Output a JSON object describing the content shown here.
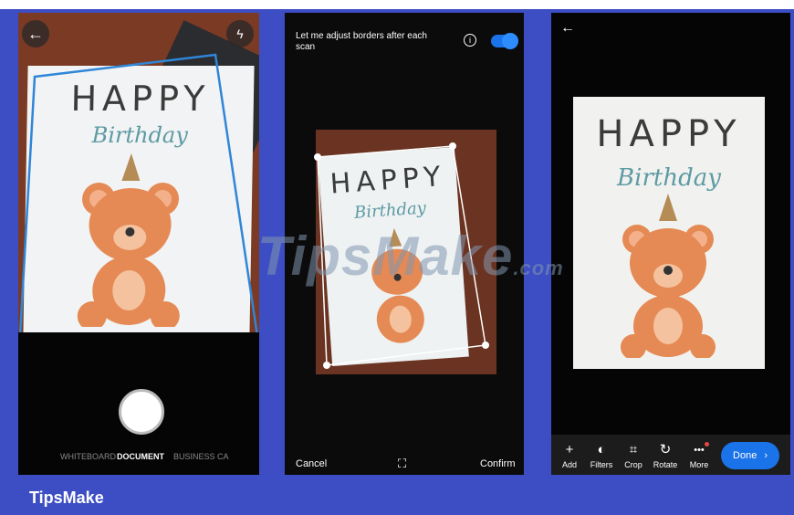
{
  "brand": "TipsMake",
  "watermark": {
    "main": "TipsMake",
    "suffix": ".com"
  },
  "card": {
    "line1": "HAPPY",
    "line2": "Birthday"
  },
  "screen1": {
    "modes": [
      "WHITEBOARD",
      "DOCUMENT",
      "BUSINESS CA"
    ],
    "selected_mode": "DOCUMENT",
    "icons": [
      "back-arrow-icon",
      "flash-off-icon",
      "shutter-button"
    ]
  },
  "screen2": {
    "adjust_text": "Let me adjust borders after each scan",
    "toggle_on": true,
    "cancel_label": "Cancel",
    "confirm_label": "Confirm"
  },
  "screen3": {
    "tools": [
      {
        "label": "Add",
        "icon": "+"
      },
      {
        "label": "Filters",
        "icon": "◐"
      },
      {
        "label": "Crop",
        "icon": "⌗"
      },
      {
        "label": "Rotate",
        "icon": "↻"
      },
      {
        "label": "More",
        "icon": "•••"
      }
    ],
    "done_label": "Done"
  },
  "colors": {
    "accent": "#1a73e8",
    "frame": "#3d4ec4",
    "crop_border": "#2f86d8"
  }
}
